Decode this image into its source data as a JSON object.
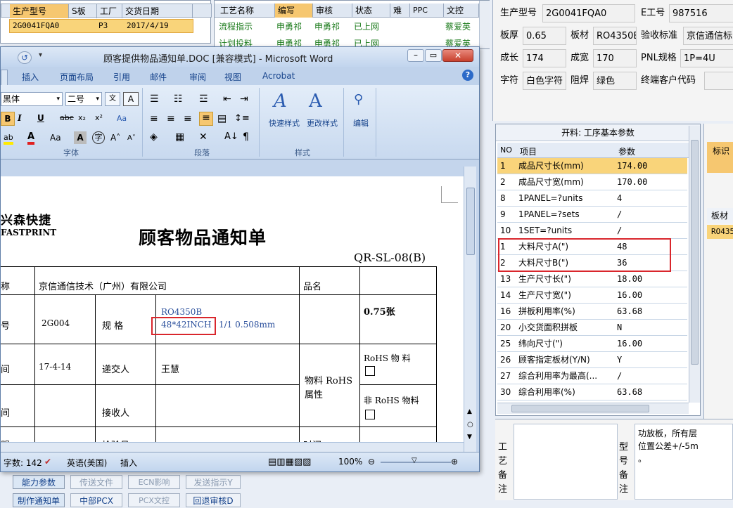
{
  "top_left_table": {
    "headers": [
      "生产型号",
      "S板",
      "工厂",
      "交货日期"
    ],
    "row": [
      "2G0041FQA0",
      "",
      "P3",
      "2017/4/19"
    ]
  },
  "process_table": {
    "headers": [
      "工艺名称",
      "编写",
      "审核",
      "状态",
      "难",
      "PPC",
      "文控"
    ],
    "rows": [
      [
        "流程指示",
        "申勇祁",
        "申勇祁",
        "已上网",
        "",
        "",
        "蔡爱英"
      ],
      [
        "计划投料",
        "申勇祁",
        "申勇祁",
        "已上网",
        "",
        "",
        "蔡爱英"
      ]
    ]
  },
  "right_form": {
    "model_label": "生产型号",
    "model_value": "2G0041FQA0",
    "e_label": "E工号",
    "e_value": "987516",
    "thickness_label": "板厚",
    "thickness_value": "0.65",
    "material_label": "板材",
    "material_value": "RO4350B",
    "accept_label": "验收标准",
    "accept_value": "京信通信标",
    "length_label": "成长",
    "length_value": "174",
    "width_label": "成宽",
    "width_value": "170",
    "pnl_label": "PNL规格",
    "pnl_value": "1P=4U",
    "char_label": "字符",
    "char_value": "白色字符",
    "mask_label": "阻焊",
    "mask_value": "绿色",
    "customer_label": "终端客户代码",
    "customer_value": ""
  },
  "params_panel": {
    "title": "开料: 工序基本参数",
    "col_no": "NO",
    "col_item": "项目",
    "col_param": "参数",
    "rows": [
      {
        "no": "1",
        "item": "成品尺寸长(mm)",
        "value": "174.00"
      },
      {
        "no": "2",
        "item": "成品尺寸宽(mm)",
        "value": "170.00"
      },
      {
        "no": "8",
        "item": "1PANEL=?units",
        "value": "4"
      },
      {
        "no": "9",
        "item": "1PANEL=?sets",
        "value": "/"
      },
      {
        "no": "10",
        "item": "1SET=?units",
        "value": "/"
      },
      {
        "no": "1",
        "item": "大料尺寸A(\")",
        "value": "48"
      },
      {
        "no": "2",
        "item": "大料尺寸B(\")",
        "value": "36"
      },
      {
        "no": "13",
        "item": "生产尺寸长(\")",
        "value": "18.00"
      },
      {
        "no": "14",
        "item": "生产尺寸宽(\")",
        "value": "16.00"
      },
      {
        "no": "16",
        "item": "拼板利用率(%)",
        "value": "63.68"
      },
      {
        "no": "20",
        "item": "小交货面积拼板",
        "value": "N"
      },
      {
        "no": "25",
        "item": "纬向尺寸(\")",
        "value": "16.00"
      },
      {
        "no": "26",
        "item": "顾客指定板材(Y/N)",
        "value": "Y"
      },
      {
        "no": "27",
        "item": "综合利用率为最高(...",
        "value": "/"
      },
      {
        "no": "30",
        "item": "综合利用率(%)",
        "value": "63.68"
      }
    ]
  },
  "side_tabs": {
    "label_mark": "标识",
    "label_material": "板材",
    "material_value": "RO435"
  },
  "bottom_right": {
    "process_note_label": "工艺备注",
    "model_note_label": "型号备注",
    "note_text_1": "功放板，所有层",
    "note_text_2": "位置公差+/-5m",
    "note_text_3": "。"
  },
  "bottom_buttons": [
    "能力参数",
    "传送文件",
    "ECN影响",
    "发送指示Y",
    "制作通知单",
    "中部PCX",
    "PCX文控",
    "回退审核D"
  ],
  "word": {
    "title": "顾客提供物品通知单.DOC [兼容模式] - Microsoft Word",
    "tabs": [
      "插入",
      "页面布局",
      "引用",
      "邮件",
      "审阅",
      "视图",
      "Acrobat"
    ],
    "font_name": "黑体",
    "font_size": "二号",
    "group_font": "字体",
    "group_para": "段落",
    "group_style": "样式",
    "quick_style": "快速样式",
    "change_style": "更改样式",
    "edit": "编辑",
    "status_words": "字数: 142",
    "status_lang": "英语(美国)",
    "status_insert": "插入",
    "zoom": "100%"
  },
  "document": {
    "logo_cn": "兴森快捷",
    "logo_en": "FASTPRINT",
    "heading": "顾客物品通知单",
    "code": "QR-SL-08(B)",
    "r1_label": "称",
    "r1_company": "京信通信技术（广州）有限公司",
    "r1_name_label": "品名",
    "r2_label": "号",
    "r2_code": "2G004",
    "r2_spec_label": "规 格",
    "r2_spec1": "RO4350B",
    "r2_spec2": "48*42INCH",
    "r2_spec3": "1/1   0.508mm",
    "r2_qty": "0.75张",
    "r3_label": "间",
    "r3_date": "17-4-14",
    "r3_sender_label": "递交人",
    "r3_sender": "王慧",
    "attr_label1": "物料 RoHS",
    "attr_label2": "属性",
    "rohs1": "RoHS   物   料",
    "r4_label": "间",
    "r4_receiver_label": "接收人",
    "rohs2": "非  RoHS  物料",
    "r5_label": "盟",
    "r5_inspect_label": "检验员",
    "r5_time_label": "时间"
  },
  "colors": {
    "highlight": "#f9d47a",
    "accent_red": "#d9262c",
    "ribbon": "#dbe7f5",
    "header_orange": "#f6c770"
  }
}
